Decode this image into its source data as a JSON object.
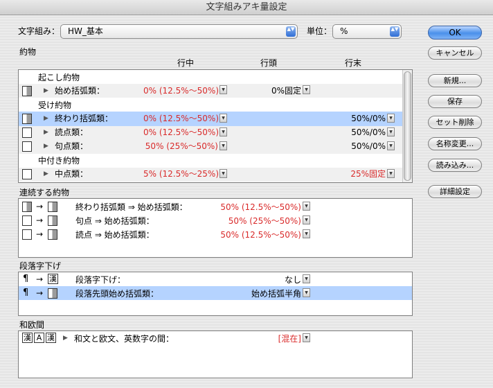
{
  "window": {
    "title": "文字組みアキ量設定"
  },
  "top": {
    "mojikumi_label": "文字組み：",
    "mojikumi_value": "HW_基本",
    "unit_label": "単位：",
    "unit_value": "%"
  },
  "buttons": {
    "ok": "OK",
    "cancel": "キャンセル",
    "new": "新規...",
    "save": "保存",
    "set_delete": "セット削除",
    "rename": "名称変更...",
    "load": "読み込み...",
    "detail": "詳細設定"
  },
  "yakumono": {
    "section_label": "約物",
    "col_middle": "行中",
    "col_head": "行頭",
    "col_end": "行末",
    "groups": [
      {
        "label": "起こし約物",
        "rows": [
          {
            "name": "始め括弧類：",
            "middle": "0% (12.5%〜50%)",
            "head": "0%固定",
            "end": "",
            "middle_red": true,
            "end_red": false
          }
        ]
      },
      {
        "label": "受け約物",
        "rows": [
          {
            "name": "終わり括弧類：",
            "middle": "0% (12.5%〜50%)",
            "head": "",
            "end": "50%/0%",
            "middle_red": true,
            "end_red": false,
            "selected": true
          },
          {
            "name": "読点類：",
            "middle": "0% (12.5%〜50%)",
            "head": "",
            "end": "50%/0%",
            "middle_red": true,
            "end_red": false
          },
          {
            "name": "句点類：",
            "middle": "50% (25%〜50%)",
            "head": "",
            "end": "50%/0%",
            "middle_red": true,
            "end_red": false
          }
        ]
      },
      {
        "label": "中付き約物",
        "rows": [
          {
            "name": "中点類：",
            "middle": "5% (12.5%〜25%)",
            "head": "",
            "end": "25%固定",
            "middle_red": true,
            "end_red": true
          }
        ]
      }
    ]
  },
  "continuous": {
    "section_label": "連続する約物",
    "rows": [
      {
        "label": "終わり括弧類 ⇒ 始め括弧類：",
        "value": "50% (12.5%〜50%)"
      },
      {
        "label": "句点 ⇒ 始め括弧類：",
        "value": "50% (25%〜50%)"
      },
      {
        "label": "読点 ⇒ 始め括弧類：",
        "value": "50% (12.5%〜50%)"
      }
    ]
  },
  "indent": {
    "section_label": "段落字下げ",
    "rows": [
      {
        "label": "段落字下げ：",
        "value": "なし"
      },
      {
        "label": "段落先頭始め括弧類：",
        "value": "始め括弧半角"
      }
    ]
  },
  "wa_o": {
    "section_label": "和欧間",
    "row_label": "和文と欧文、英数字の間：",
    "value": "[混在]"
  },
  "glyphs": {
    "kanji": "漢",
    "alpha": "A",
    "arrow": "→",
    "pilcrow": "¶",
    "triangle": "▶",
    "dropdown": "▼",
    "stepper": "▲▼"
  },
  "colors": {
    "accent": "#4a90ea",
    "selection": "#b5d3ff",
    "red_value": "#d92a2a"
  }
}
